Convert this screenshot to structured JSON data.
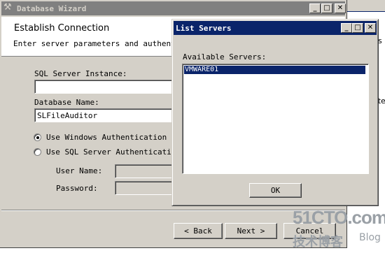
{
  "wizard": {
    "title": "Database Wizard",
    "heading": "Establish Connection",
    "subheading": "Enter server parameters and authentication",
    "sql_instance_label": "SQL Server Instance:",
    "sql_instance_value": "",
    "db_name_label": "Database Name:",
    "db_name_value": "SLFileAuditor",
    "auth_windows_label": "Use Windows Authentication",
    "auth_sql_label": "Use SQL Server Authentication",
    "auth_selected": "windows",
    "username_label": "User Name:",
    "password_label": "Password:",
    "back_label": "< Back",
    "next_label": "Next >",
    "cancel_label": "Cancel"
  },
  "dialog": {
    "title": "List Servers",
    "available_label": "Available Servers:",
    "servers": [
      "VMWARE01"
    ],
    "selected_index": 0,
    "ok_label": "OK"
  },
  "background": {
    "right_fragment_1": "s",
    "right_fragment_2": "ste"
  },
  "watermark": {
    "site": "51CTO.com",
    "tagline": "技术博客",
    "blog": "Blog"
  },
  "colors": {
    "title_active": "#0a246a",
    "title_inactive": "#808080",
    "selection": "#0a246a",
    "watermark": "#9aa0a6"
  }
}
